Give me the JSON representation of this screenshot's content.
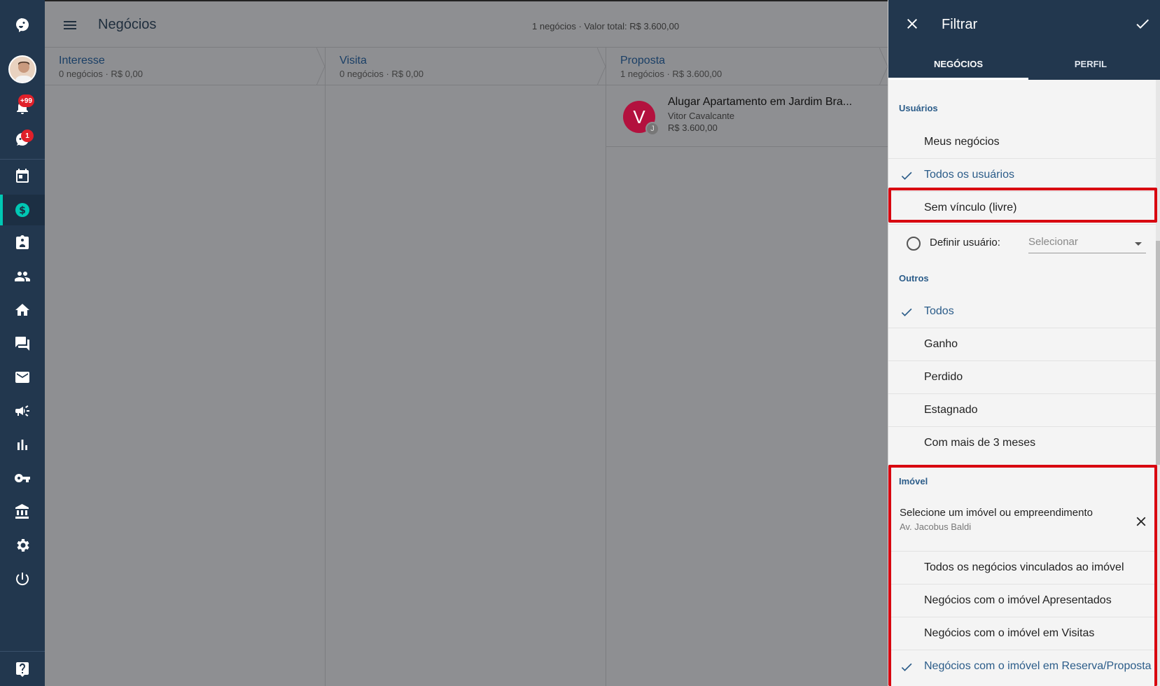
{
  "sidebar": {
    "notifications_badge": "+99",
    "chat_badge": "1",
    "icons": [
      "logo-icon",
      "avatar",
      "bell-icon",
      "chat-bot-icon",
      "calendar-icon",
      "dollar-icon",
      "contact-badge-icon",
      "people-icon",
      "home-icon",
      "forum-icon",
      "mail-icon",
      "megaphone-icon",
      "bar-chart-icon",
      "key-icon",
      "bank-icon",
      "gear-icon",
      "power-icon",
      "help-icon"
    ]
  },
  "header": {
    "title": "Negócios",
    "summary": "1 negócios · Valor total: R$ 3.600,00"
  },
  "columns": [
    {
      "title": "Interesse",
      "subtitle": "0 negócios · R$ 0,00"
    },
    {
      "title": "Visita",
      "subtitle": "0 negócios · R$ 0,00"
    },
    {
      "title": "Proposta",
      "subtitle": "1 negócios · R$ 3.600,00"
    }
  ],
  "card": {
    "avatar_letter": "V",
    "avatar_mini": "J",
    "title": "Alugar Apartamento em Jardim Bra...",
    "user": "Vitor Cavalcante",
    "value": "R$ 3.600,00"
  },
  "filter": {
    "title": "Filtrar",
    "tabs": [
      {
        "label": "NEGÓCIOS",
        "active": true
      },
      {
        "label": "PERFIL",
        "active": false
      }
    ],
    "usuarios": {
      "label": "Usuários",
      "options": [
        {
          "label": "Meus negócios",
          "selected": false
        },
        {
          "label": "Todos os usuários",
          "selected": true
        },
        {
          "label": "Sem vínculo (livre)",
          "selected": false
        }
      ],
      "define_label": "Definir usuário:",
      "define_placeholder": "Selecionar"
    },
    "outros": {
      "label": "Outros",
      "options": [
        {
          "label": "Todos",
          "selected": true
        },
        {
          "label": "Ganho",
          "selected": false
        },
        {
          "label": "Perdido",
          "selected": false
        },
        {
          "label": "Estagnado",
          "selected": false
        },
        {
          "label": "Com mais de 3 meses",
          "selected": false
        }
      ]
    },
    "imovel": {
      "label": "Imóvel",
      "select_title": "Selecione um imóvel ou empreendimento",
      "select_value": "Av. Jacobus Baldi",
      "options": [
        {
          "label": "Todos os negócios vinculados ao imóvel",
          "selected": false
        },
        {
          "label": "Negócios com o imóvel Apresentados",
          "selected": false
        },
        {
          "label": "Negócios com o imóvel em Visitas",
          "selected": false
        },
        {
          "label": "Negócios com o imóvel em Reserva/Proposta",
          "selected": true
        }
      ]
    }
  },
  "colors": {
    "sidebar_bg": "#22374e",
    "accent_teal": "#00c8b4",
    "selected_text": "#2b5c89",
    "highlight_red": "#d8000f",
    "badge_red": "#e0202a"
  }
}
